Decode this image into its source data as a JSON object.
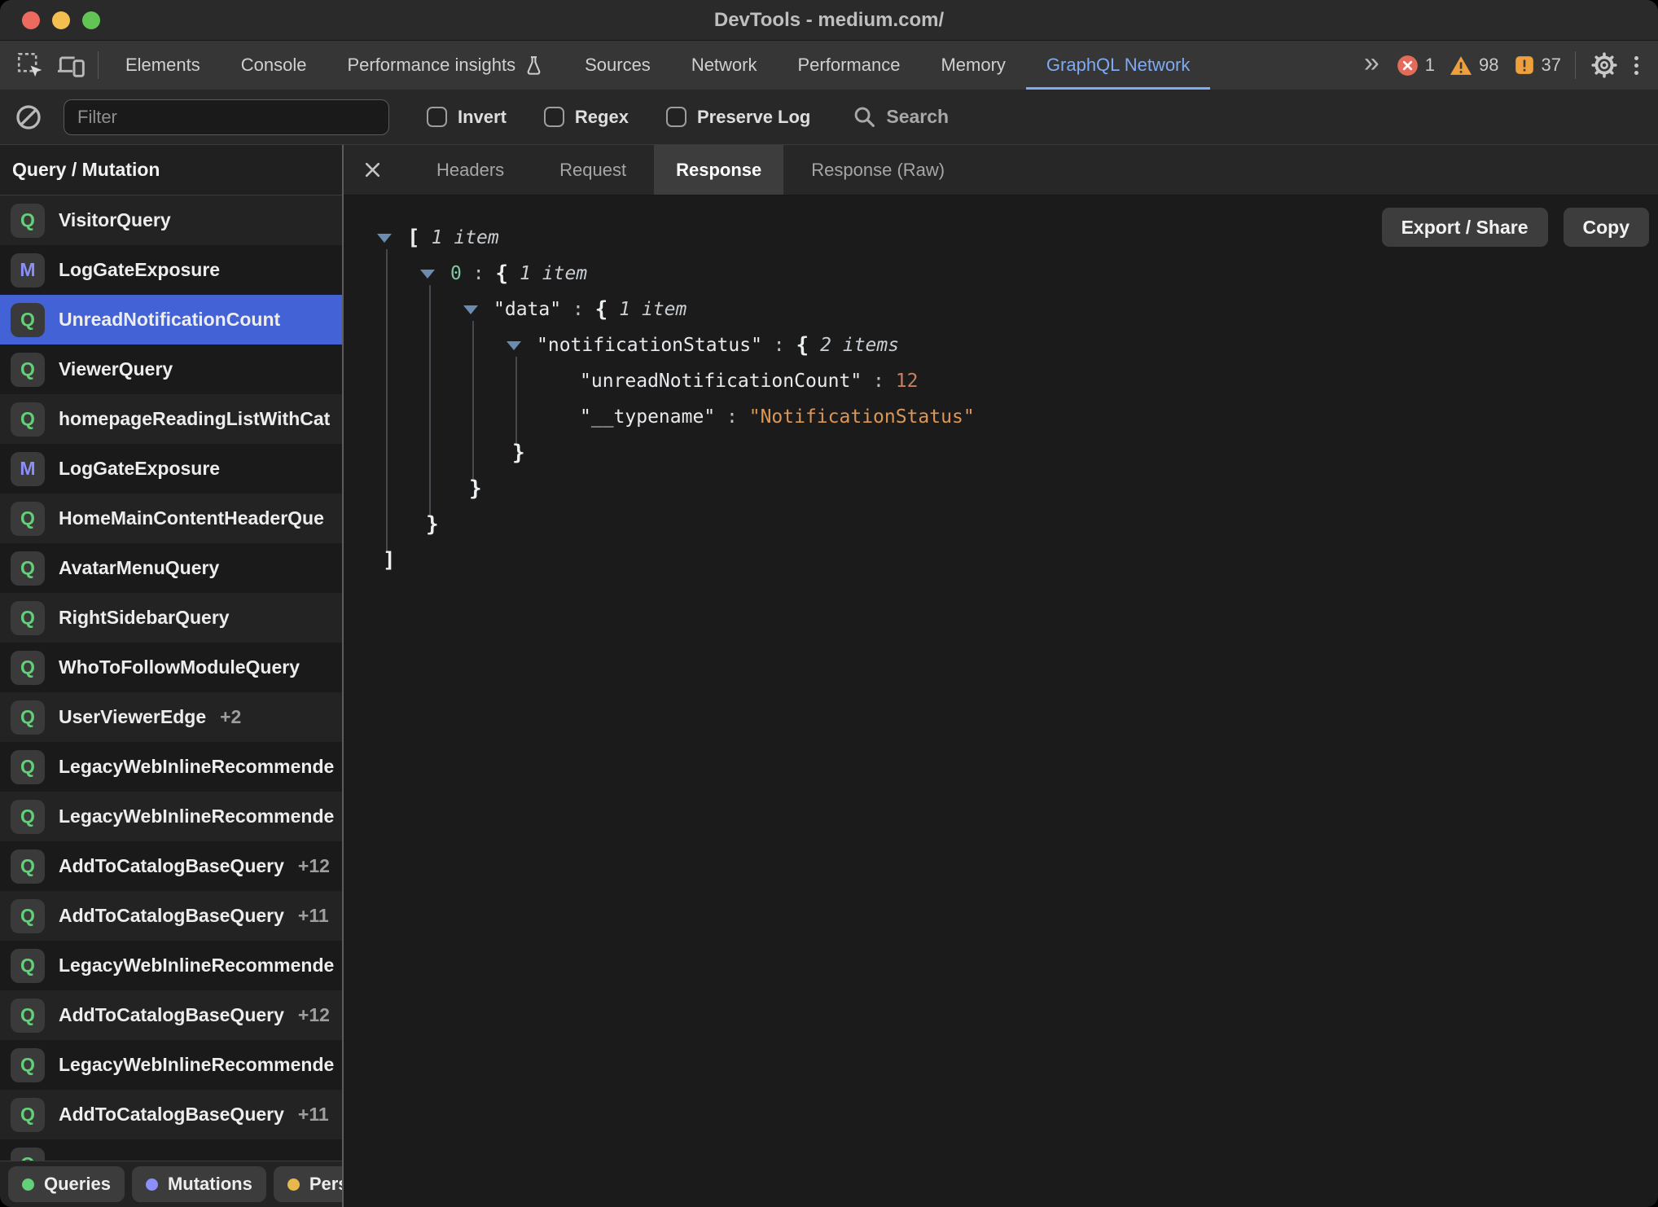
{
  "window": {
    "title": "DevTools - medium.com/"
  },
  "colors": {
    "accent_blue": "#7faaf4",
    "selection_blue": "#4262d6",
    "query_green": "#63cf78",
    "mutation_purple": "#8b8ff7",
    "persisted_yellow": "#e7b94c",
    "warning_orange": "#eda03c",
    "error_red": "#e46a5a"
  },
  "devtools_tabs": {
    "items": [
      {
        "label": "Elements",
        "active": false
      },
      {
        "label": "Console",
        "active": false
      },
      {
        "label": "Performance insights",
        "active": false,
        "icon": "flask"
      },
      {
        "label": "Sources",
        "active": false
      },
      {
        "label": "Network",
        "active": false
      },
      {
        "label": "Performance",
        "active": false
      },
      {
        "label": "Memory",
        "active": false
      },
      {
        "label": "GraphQL Network",
        "active": true
      }
    ],
    "overflow_chevron": "»",
    "badges": {
      "errors": "1",
      "warnings": "98",
      "issues": "37"
    }
  },
  "filterbar": {
    "filter_placeholder": "Filter",
    "checkboxes": [
      {
        "label": "Invert",
        "checked": false
      },
      {
        "label": "Regex",
        "checked": false
      },
      {
        "label": "Preserve Log",
        "checked": false
      }
    ],
    "search_label": "Search"
  },
  "sidebar": {
    "header": "Query / Mutation",
    "items": [
      {
        "badge": "Q",
        "name": "VisitorQuery"
      },
      {
        "badge": "M",
        "name": "LogGateExposure"
      },
      {
        "badge": "Q",
        "name": "UnreadNotificationCount",
        "selected": true
      },
      {
        "badge": "Q",
        "name": "ViewerQuery"
      },
      {
        "badge": "Q",
        "name": "homepageReadingListWithCat"
      },
      {
        "badge": "M",
        "name": "LogGateExposure"
      },
      {
        "badge": "Q",
        "name": "HomeMainContentHeaderQue"
      },
      {
        "badge": "Q",
        "name": "AvatarMenuQuery"
      },
      {
        "badge": "Q",
        "name": "RightSidebarQuery"
      },
      {
        "badge": "Q",
        "name": "WhoToFollowModuleQuery"
      },
      {
        "badge": "Q",
        "name": "UserViewerEdge",
        "count": "+2"
      },
      {
        "badge": "Q",
        "name": "LegacyWebInlineRecommende"
      },
      {
        "badge": "Q",
        "name": "LegacyWebInlineRecommende"
      },
      {
        "badge": "Q",
        "name": "AddToCatalogBaseQuery",
        "count": "+12"
      },
      {
        "badge": "Q",
        "name": "AddToCatalogBaseQuery",
        "count": "+11"
      },
      {
        "badge": "Q",
        "name": "LegacyWebInlineRecommende"
      },
      {
        "badge": "Q",
        "name": "AddToCatalogBaseQuery",
        "count": "+12"
      },
      {
        "badge": "Q",
        "name": "LegacyWebInlineRecommende"
      },
      {
        "badge": "Q",
        "name": "AddToCatalogBaseQuery",
        "count": "+11"
      },
      {
        "badge": "Q",
        "name": ""
      }
    ],
    "filters": [
      {
        "label": "Queries",
        "color": "#63cf78"
      },
      {
        "label": "Mutations",
        "color": "#8b8ff7"
      },
      {
        "label": "Pers",
        "color": "#e7b94c"
      }
    ]
  },
  "response_panel": {
    "tabs": [
      {
        "label": "Headers",
        "active": false
      },
      {
        "label": "Request",
        "active": false
      },
      {
        "label": "Response",
        "active": true
      },
      {
        "label": "Response (Raw)",
        "active": false
      }
    ],
    "buttons": {
      "export": "Export / Share",
      "copy": "Copy"
    },
    "tree": {
      "rows": [
        {
          "indent": 0,
          "tri": true,
          "parts": [
            {
              "t": "bracket",
              "v": "["
            },
            {
              "t": "meta",
              "v": "1 item"
            }
          ]
        },
        {
          "indent": 1,
          "tri": true,
          "parts": [
            {
              "t": "idx",
              "v": "0"
            },
            {
              "t": "colon",
              "v": " : "
            },
            {
              "t": "bracket",
              "v": "{"
            },
            {
              "t": "meta",
              "v": "1 item"
            }
          ]
        },
        {
          "indent": 2,
          "tri": true,
          "parts": [
            {
              "t": "key",
              "v": "\"data\""
            },
            {
              "t": "colon",
              "v": " : "
            },
            {
              "t": "bracket",
              "v": "{"
            },
            {
              "t": "meta",
              "v": "1 item"
            }
          ]
        },
        {
          "indent": 3,
          "tri": true,
          "parts": [
            {
              "t": "key",
              "v": "\"notificationStatus\""
            },
            {
              "t": "colon",
              "v": " : "
            },
            {
              "t": "bracket",
              "v": "{"
            },
            {
              "t": "meta",
              "v": "2 items"
            }
          ]
        },
        {
          "indent": 4,
          "tri": false,
          "parts": [
            {
              "t": "key",
              "v": "\"unreadNotificationCount\""
            },
            {
              "t": "colon",
              "v": " : "
            },
            {
              "t": "num",
              "v": "12"
            }
          ]
        },
        {
          "indent": 4,
          "tri": false,
          "parts": [
            {
              "t": "key",
              "v": "\"__typename\""
            },
            {
              "t": "colon",
              "v": " : "
            },
            {
              "t": "str",
              "v": "\"NotificationStatus\""
            }
          ]
        },
        {
          "indent": 3,
          "tri": false,
          "close": true,
          "parts": [
            {
              "t": "bracket",
              "v": "}"
            }
          ]
        },
        {
          "indent": 2,
          "tri": false,
          "close": true,
          "parts": [
            {
              "t": "bracket",
              "v": "}"
            }
          ]
        },
        {
          "indent": 1,
          "tri": false,
          "close": true,
          "parts": [
            {
              "t": "bracket",
              "v": "}"
            }
          ]
        },
        {
          "indent": 0,
          "tri": false,
          "close": true,
          "parts": [
            {
              "t": "bracket",
              "v": "]"
            }
          ]
        }
      ]
    }
  }
}
